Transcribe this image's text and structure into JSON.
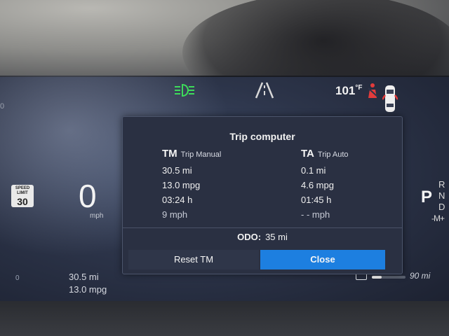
{
  "status": {
    "temperature": "101",
    "temperature_unit": "°F",
    "edge_label": "0"
  },
  "left_cluster": {
    "speed_limit_label": "SPEED LIMIT",
    "speed_limit_value": "30",
    "speed": "0",
    "speed_unit": "mph"
  },
  "right_cluster": {
    "gear_current": "P",
    "gears": [
      "R",
      "N",
      "D",
      "-M+"
    ]
  },
  "bottom": {
    "zero_label": "0",
    "distance": "30.5 mi",
    "mpg": "13.0 mpg",
    "range": "90 mi",
    "fuel_level_fraction": 0.3
  },
  "trip_computer": {
    "title": "Trip computer",
    "manual": {
      "abbr": "TM",
      "label": "Trip Manual",
      "distance": "30.5 mi",
      "economy": "13.0 mpg",
      "time": "03:24 h",
      "speed": "9 mph"
    },
    "auto": {
      "abbr": "TA",
      "label": "Trip Auto",
      "distance": "0.1 mi",
      "economy": "4.6 mpg",
      "time": "01:45 h",
      "speed": "- - mph"
    },
    "odo_label": "ODO:",
    "odo_value": "35 mi",
    "reset_label": "Reset TM",
    "close_label": "Close"
  },
  "colors": {
    "headlight_green": "#3ddc5a",
    "warning_red": "#e23b3b",
    "accent_blue": "#1d7fe0"
  },
  "icons": [
    "headlight-icon",
    "lane-assist-icon",
    "seatbelt-warning-icon",
    "car-door-icon",
    "fuel-pump-icon"
  ]
}
